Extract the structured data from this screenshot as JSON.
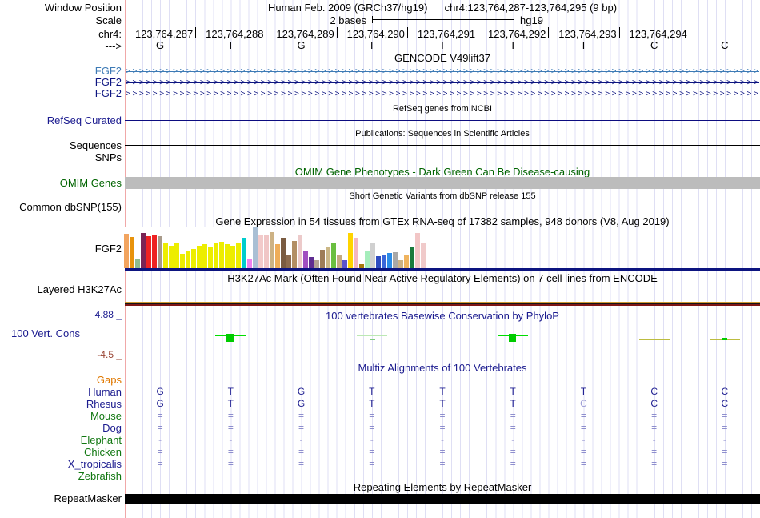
{
  "header": {
    "window_position_label": "Window Position",
    "assembly": "Human Feb. 2009 (GRCh37/hg19)",
    "position": "chr4:123,764,287-123,764,295 (9 bp)",
    "scale_label": "Scale",
    "scale_value": "2 bases",
    "scale_assembly": "hg19",
    "chrom_label": "chr4:",
    "strand_label": "--->",
    "coordinates": [
      "123,764,287",
      "123,764,288",
      "123,764,289",
      "123,764,290",
      "123,764,291",
      "123,764,292",
      "123,764,293",
      "123,764,294"
    ],
    "bases": [
      "G",
      "T",
      "G",
      "T",
      "T",
      "T",
      "T",
      "C",
      "C"
    ]
  },
  "colors": {
    "label_navy": "#1b1b8f",
    "line_navy": "#0c0c80",
    "gene_light_blue": "#3d7ab5",
    "gene_navy": "#0c1480",
    "green_label": "#117711",
    "omim_green": "#006400",
    "gaps_orange": "#e07800",
    "phylop_neg_label": "#994433",
    "omim_bar_gray": "#bcbcbc",
    "align_mark": "#8282c8",
    "muted_base": "#9a9ad4",
    "repeat_bar": "#000000"
  },
  "tracks": {
    "gencode": {
      "title": "GENCODE V49lift37",
      "genes": [
        {
          "label": "FGF2",
          "color": "#3d7ab5"
        },
        {
          "label": "FGF2",
          "color": "#0c1480"
        },
        {
          "label": "FGF2",
          "color": "#0c1480"
        }
      ]
    },
    "refseq": {
      "title": "RefSeq genes from NCBI",
      "label": "RefSeq Curated"
    },
    "publications": {
      "title": "Publications: Sequences in Scientific Articles",
      "label": "Sequences"
    },
    "snps": {
      "label": "SNPs"
    },
    "omim": {
      "title": "OMIM Gene Phenotypes - Dark Green Can Be Disease-causing",
      "label": "OMIM Genes"
    },
    "dbsnp": {
      "title": "Short Genetic Variants from dbSNP release 155",
      "label": "Common dbSNP(155)"
    },
    "gtex": {
      "title": "Gene Expression in 54 tissues from GTEx RNA-seq of 17382 samples, 948 donors (V8, Aug 2019)",
      "label": "FGF2"
    },
    "h3k27ac": {
      "title": "H3K27Ac Mark (Often Found Near Active Regulatory Elements) on 7 cell lines from ENCODE",
      "label": "Layered H3K27Ac"
    },
    "phylop": {
      "title": "100 vertebrates Basewise Conservation by PhyloP",
      "label": "100 Vert. Cons",
      "max": "4.88 _",
      "min": "-4.5 _"
    },
    "multiz": {
      "title": "Multiz Alignments of 100 Vertebrates",
      "rows": [
        {
          "label": "Gaps",
          "label_color": "#e07800",
          "cell_color": "",
          "cells": [
            "",
            "",
            "",
            "",
            "",
            "",
            "",
            "",
            ""
          ]
        },
        {
          "label": "Human",
          "label_color": "#1b1b8f",
          "cell_color": "#1b1b8f",
          "cells": [
            "G",
            "T",
            "G",
            "T",
            "T",
            "T",
            "T",
            "C",
            "C"
          ]
        },
        {
          "label": "Rhesus",
          "label_color": "#1b1b8f",
          "cell_color": "#1b1b8f",
          "muted": [
            6
          ],
          "cells": [
            "G",
            "T",
            "G",
            "T",
            "T",
            "T",
            "C",
            "C",
            "C"
          ]
        },
        {
          "label": "Mouse",
          "label_color": "#117711",
          "cell_color": "#8282c8",
          "cells": [
            "=",
            "=",
            "=",
            "=",
            "=",
            "=",
            "=",
            "=",
            "="
          ]
        },
        {
          "label": "Dog",
          "label_color": "#1b1b8f",
          "cell_color": "#8282c8",
          "cells": [
            "=",
            "=",
            "=",
            "=",
            "=",
            "=",
            "=",
            "=",
            "="
          ]
        },
        {
          "label": "Elephant",
          "label_color": "#117711",
          "cell_color": "#8282c8",
          "cells": [
            "-",
            "-",
            "-",
            "-",
            "-",
            "-",
            "-",
            "-",
            "-"
          ]
        },
        {
          "label": "Chicken",
          "label_color": "#117711",
          "cell_color": "#8282c8",
          "cells": [
            "=",
            "=",
            "=",
            "=",
            "=",
            "=",
            "=",
            "=",
            "="
          ]
        },
        {
          "label": "X_tropicalis",
          "label_color": "#1b1b8f",
          "cell_color": "#8282c8",
          "cells": [
            "=",
            "=",
            "=",
            "=",
            "=",
            "=",
            "=",
            "=",
            "="
          ]
        },
        {
          "label": "Zebrafish",
          "label_color": "#117711",
          "cell_color": "",
          "cells": [
            "",
            "",
            "",
            "",
            "",
            "",
            "",
            "",
            ""
          ]
        }
      ]
    },
    "repeatmasker": {
      "title": "Repeating Elements by RepeatMasker",
      "label": "RepeatMasker"
    }
  },
  "chart_data": [
    {
      "type": "bar",
      "title": "Gene Expression in 54 tissues from GTEx RNA-seq of 17382 samples, 948 donors (V8, Aug 2019)",
      "gene": "FGF2",
      "ylim": [
        0,
        1
      ],
      "note": "54 tissue bars; tissue names not shown in image; values are relative bar heights estimated from pixels",
      "values": [
        0.84,
        0.76,
        0.22,
        0.86,
        0.78,
        0.8,
        0.78,
        0.6,
        0.54,
        0.62,
        0.36,
        0.42,
        0.48,
        0.55,
        0.58,
        0.52,
        0.62,
        0.64,
        0.58,
        0.55,
        0.6,
        0.74,
        0.22,
        1.0,
        0.82,
        0.8,
        0.88,
        0.58,
        0.75,
        0.32,
        0.66,
        0.8,
        0.44,
        0.28,
        0.2,
        0.46,
        0.5,
        0.63,
        0.34,
        0.2,
        0.86,
        0.74,
        0.1,
        0.44,
        0.6,
        0.3,
        0.34,
        0.38,
        0.4,
        0.2,
        0.34,
        0.5,
        0.86,
        0.62
      ],
      "colors": [
        "#f2a45f",
        "#e8930c",
        "#8fbc8f",
        "#7a2455",
        "#ee2222",
        "#ee2222",
        "#a89a8a",
        "#eded00",
        "#eded00",
        "#eded00",
        "#eded00",
        "#eded00",
        "#eded00",
        "#eded00",
        "#eded00",
        "#eded00",
        "#eded00",
        "#eded00",
        "#eded00",
        "#eded00",
        "#eded00",
        "#00cdcd",
        "#ee82ee",
        "#a9bfd4",
        "#f2caca",
        "#f0c6c6",
        "#cdb284",
        "#efad59",
        "#7a5b41",
        "#8d6b4e",
        "#b28e64",
        "#eccaca",
        "#a04fc0",
        "#5f2d91",
        "#b3a395",
        "#9e7d57",
        "#cbb786",
        "#6abf40",
        "#c4aa82",
        "#5a52cc",
        "#ffd400",
        "#f4b6c2",
        "#a67c0a",
        "#a5edbb",
        "#d0d0d0",
        "#2f4bc0",
        "#3a66d9",
        "#2b8ce8",
        "#a8a8a8",
        "#cdb284",
        "#f0b45f",
        "#1a7a3c",
        "#f2c6c6",
        "#f0caca"
      ]
    },
    {
      "type": "area",
      "title": "100 vertebrates Basewise Conservation by PhyloP",
      "ylim": [
        -4.5,
        4.88
      ],
      "x_bases": [
        "G",
        "T",
        "G",
        "T",
        "T",
        "T",
        "T",
        "C",
        "C"
      ],
      "marks": [
        {
          "base": 1,
          "kind": "strong"
        },
        {
          "base": 3,
          "kind": "faint"
        },
        {
          "base": 5,
          "kind": "strong"
        },
        {
          "base": 7,
          "kind": "neg"
        },
        {
          "base": 8,
          "kind": "neg-tick"
        }
      ]
    }
  ]
}
